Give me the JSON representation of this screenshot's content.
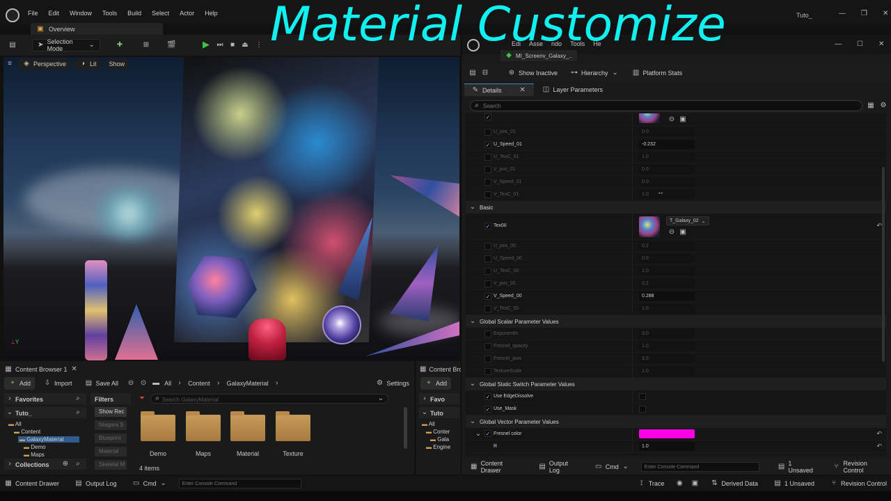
{
  "overlay_title": "Material Customize",
  "menu": [
    "File",
    "Edit",
    "Window",
    "Tools",
    "Build",
    "Select",
    "Actor",
    "Help"
  ],
  "project_name": "Tuto_",
  "overview_tab": "Overview",
  "toolbar": {
    "selection_mode": "Selection Mode"
  },
  "viewport": {
    "perspective": "Perspective",
    "lit": "Lit",
    "show": "Show"
  },
  "mat_window": {
    "menu": [
      "Edi",
      "Asse",
      "ndo",
      "Tools",
      "He"
    ],
    "tab_title": "MI_Screenv_Galaxy_..",
    "show_inactive": "Show Inactive",
    "hierarchy": "Hierarchy",
    "platform_stats": "Platform Stats",
    "details_tab": "Details",
    "layer_params_tab": "Layer Parameters",
    "search_placeholder": "Search"
  },
  "props_top": [
    {
      "name": "U_pos_01",
      "value": "0.0",
      "checked": false
    },
    {
      "name": "U_Speed_01",
      "value": "-0.232",
      "checked": true
    },
    {
      "name": "U_TexC_01",
      "value": "1.0",
      "checked": false
    },
    {
      "name": "V_pos_01",
      "value": "0.0",
      "checked": false
    },
    {
      "name": "V_Speed_01",
      "value": "0.0",
      "checked": false
    },
    {
      "name": "V_TexC_01",
      "value": "1.0",
      "checked": false
    }
  ],
  "section_basic": "Basic",
  "tex00": {
    "name": "Tex00",
    "texture": "T_Galaxy_02"
  },
  "props_basic": [
    {
      "name": "U_pos_00",
      "value": "0.2",
      "checked": false
    },
    {
      "name": "U_Speed_00",
      "value": "0.0",
      "checked": false
    },
    {
      "name": "U_TexC_00",
      "value": "1.0",
      "checked": false
    },
    {
      "name": "V_pos_00",
      "value": "0.2",
      "checked": false
    },
    {
      "name": "V_Speed_00",
      "value": "0.288",
      "checked": true
    },
    {
      "name": "V_TexC_00",
      "value": "1.0",
      "checked": false
    }
  ],
  "section_scalar": "Global Scalar Parameter Values",
  "props_scalar": [
    {
      "name": "ExponentIn",
      "value": "3.0",
      "checked": false
    },
    {
      "name": "Fresnel_opacity",
      "value": "1.0",
      "checked": false
    },
    {
      "name": "Fresnel_pow",
      "value": "3.0",
      "checked": false
    },
    {
      "name": "TextureScale",
      "value": "1.0",
      "checked": false
    }
  ],
  "section_switch": "Global Static Switch Parameter Values",
  "props_switch": [
    {
      "name": "Use EdgeDissolve",
      "checked": true
    },
    {
      "name": "Use_Mask",
      "checked": true
    }
  ],
  "section_vector": "Global Vector Parameter Values",
  "fresnel_color": {
    "name": "Fresnel color",
    "color": "#ff00e6",
    "r_label": "R",
    "r_value": "1.0"
  },
  "mat_status": {
    "content_drawer": "Content Drawer",
    "output_log": "Output Log",
    "cmd": "Cmd",
    "console_placeholder": "Enter Console Command",
    "unsaved": "1 Unsaved",
    "revision_control": "Revision Control"
  },
  "content_browser": {
    "title": "Content Browser 1",
    "add": "Add",
    "import": "Import",
    "save_all": "Save All",
    "path": [
      "All",
      "Content",
      "GalaxyMaterial"
    ],
    "settings": "Settings",
    "favorites": "Favorites",
    "tree_root": "Tuto_",
    "tree": [
      "All",
      "Content",
      "GalaxyMaterial",
      "Demo",
      "Maps"
    ],
    "collections": "Collections",
    "filters": "Filters",
    "filter_items": [
      "Show Rec",
      "Niagara S",
      "Blueprint",
      "Material",
      "Skeletal M"
    ],
    "search_placeholder": "Search GalaxyMaterial",
    "folders": [
      "Demo",
      "Maps",
      "Material",
      "Texture"
    ],
    "item_count": "4 items"
  },
  "content_browser_2": {
    "title": "Content Bro",
    "add": "Add",
    "favorites": "Favo",
    "tree_root": "Tuto",
    "tree": [
      "All",
      "Conter",
      "Gala",
      "Engine"
    ]
  },
  "status": {
    "content_drawer": "Content Drawer",
    "output_log": "Output Log",
    "cmd": "Cmd",
    "console_placeholder": "Enter Console Command",
    "trace": "Trace",
    "derived_data": "Derived Data",
    "unsaved": "1 Unsaved",
    "revision_control": "Revision Control"
  },
  "colors": {
    "accent": "#10f0f0",
    "selection": "#2e5a8e",
    "play": "#3ec43e",
    "folder": "#c69a5a"
  }
}
